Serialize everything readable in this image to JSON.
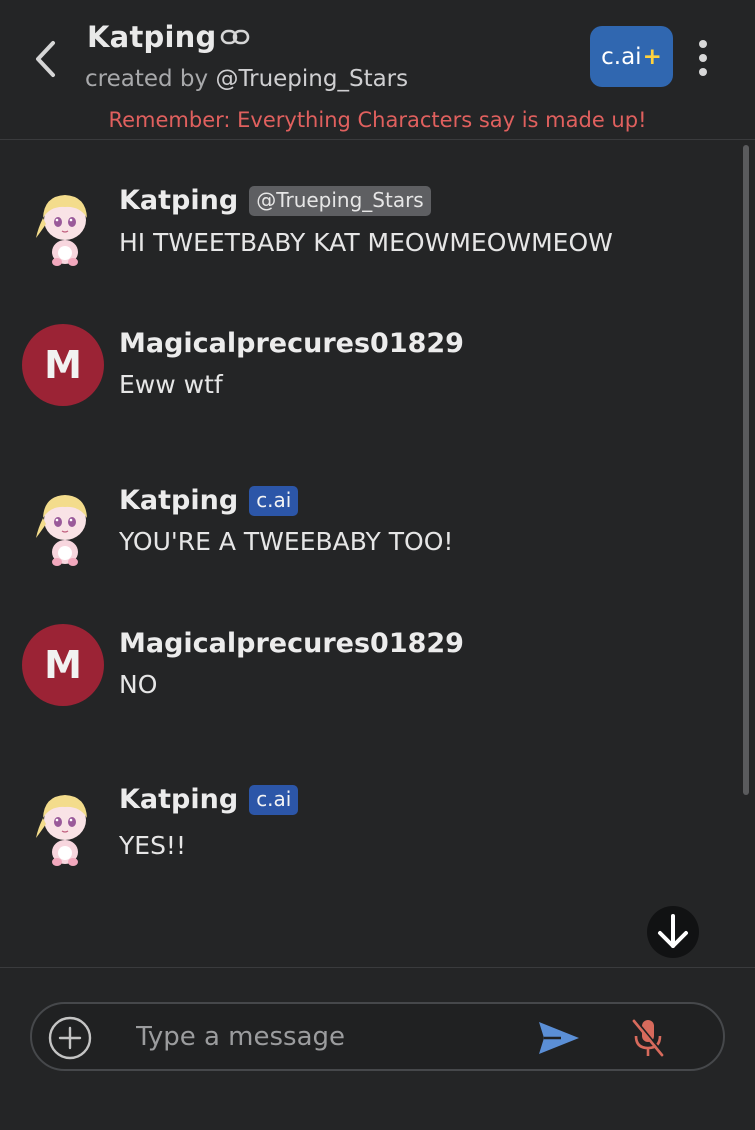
{
  "header": {
    "character_name": "Katping",
    "created_by_prefix": "created by ",
    "creator_handle": "@Trueping_Stars",
    "plus_button_label": "c.ai",
    "plus_button_suffix": "+",
    "disclaimer": "Remember: Everything Characters say is made up!"
  },
  "messages": [
    {
      "sender": "Katping",
      "badge": "@Trueping_Stars",
      "badge_style": "gray",
      "text": "HI TWEETBABY KAT MEOWMEOWMEOW",
      "avatar": "katping-avatar"
    },
    {
      "sender": "Magicalprecures01829",
      "avatar_letter": "M",
      "text": "Eww wtf"
    },
    {
      "sender": "Katping",
      "badge": "c.ai",
      "badge_style": "blue",
      "text": "YOU'RE A TWEEBABY TOO!",
      "avatar": "katping-avatar"
    },
    {
      "sender": "Magicalprecures01829",
      "avatar_letter": "M",
      "text": "NO"
    },
    {
      "sender": "Katping",
      "badge": "c.ai",
      "badge_style": "blue",
      "text": "YES!!",
      "avatar": "katping-avatar"
    }
  ],
  "composer": {
    "placeholder": "Type a message",
    "value": ""
  },
  "colors": {
    "background": "#242526",
    "accent_blue": "#3067b0",
    "disclaimer_red": "#e0605e",
    "user_avatar": "#9b2335",
    "send_icon": "#5b8fd6",
    "mic_muted": "#d76a5c"
  },
  "icons": [
    "back-chevron-icon",
    "link-icon",
    "more-vertical-icon",
    "arrow-down-icon",
    "plus-circle-icon",
    "send-icon",
    "mic-off-icon"
  ]
}
